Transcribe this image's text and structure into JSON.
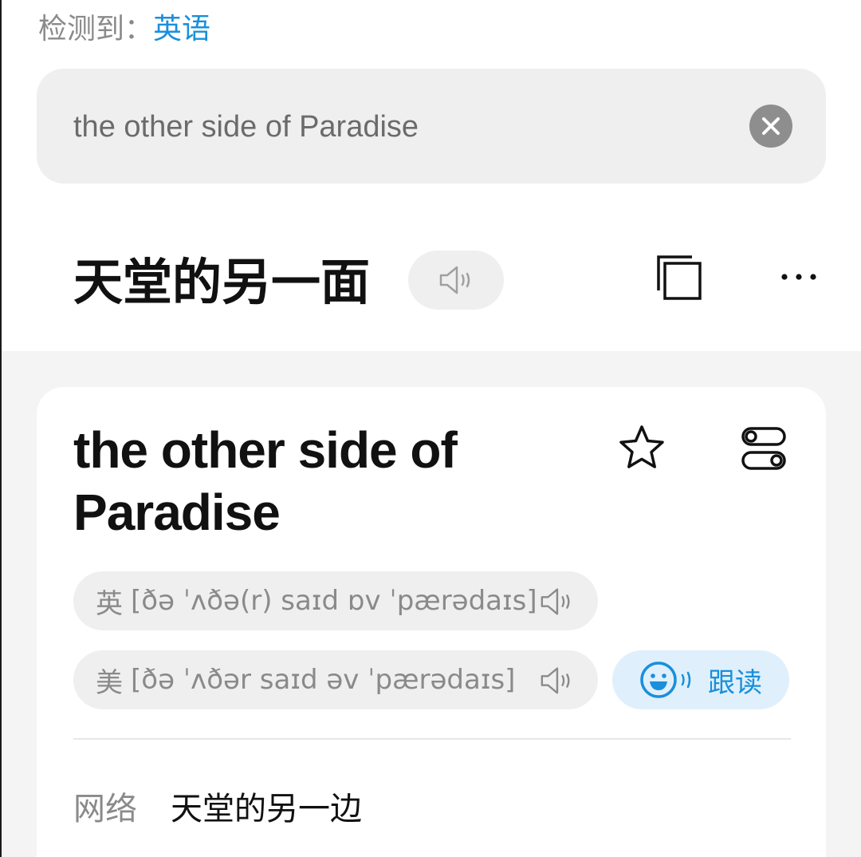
{
  "detected": {
    "label": "检测到：",
    "language": "英语"
  },
  "input": {
    "value": "the other side of Paradise"
  },
  "result": {
    "translation": "天堂的另一面"
  },
  "card": {
    "phrase": "the other side of Paradise",
    "pronunciations": [
      {
        "region": "英",
        "ipa": "[ðə ˈʌðə(r) saɪd ɒv ˈpærədaɪs]"
      },
      {
        "region": "美",
        "ipa": "[ðə ˈʌðər saɪd əv ˈpærədaɪs]"
      }
    ],
    "follow_read_label": "跟读",
    "web": {
      "tag": "网络",
      "meaning": "天堂的另一边"
    }
  },
  "icons": {
    "clear": "close-circle-icon",
    "speaker": "speaker-icon",
    "copy": "copy-icon",
    "more": "more-horizontal-icon",
    "star": "star-icon",
    "toggle": "toggle-settings-icon",
    "follow": "smile-face-icon"
  },
  "colors": {
    "accent": "#1a8fdc",
    "pill_bg": "#efefef",
    "page_bg": "#f4f4f4",
    "follow_bg": "#dff0fc"
  }
}
